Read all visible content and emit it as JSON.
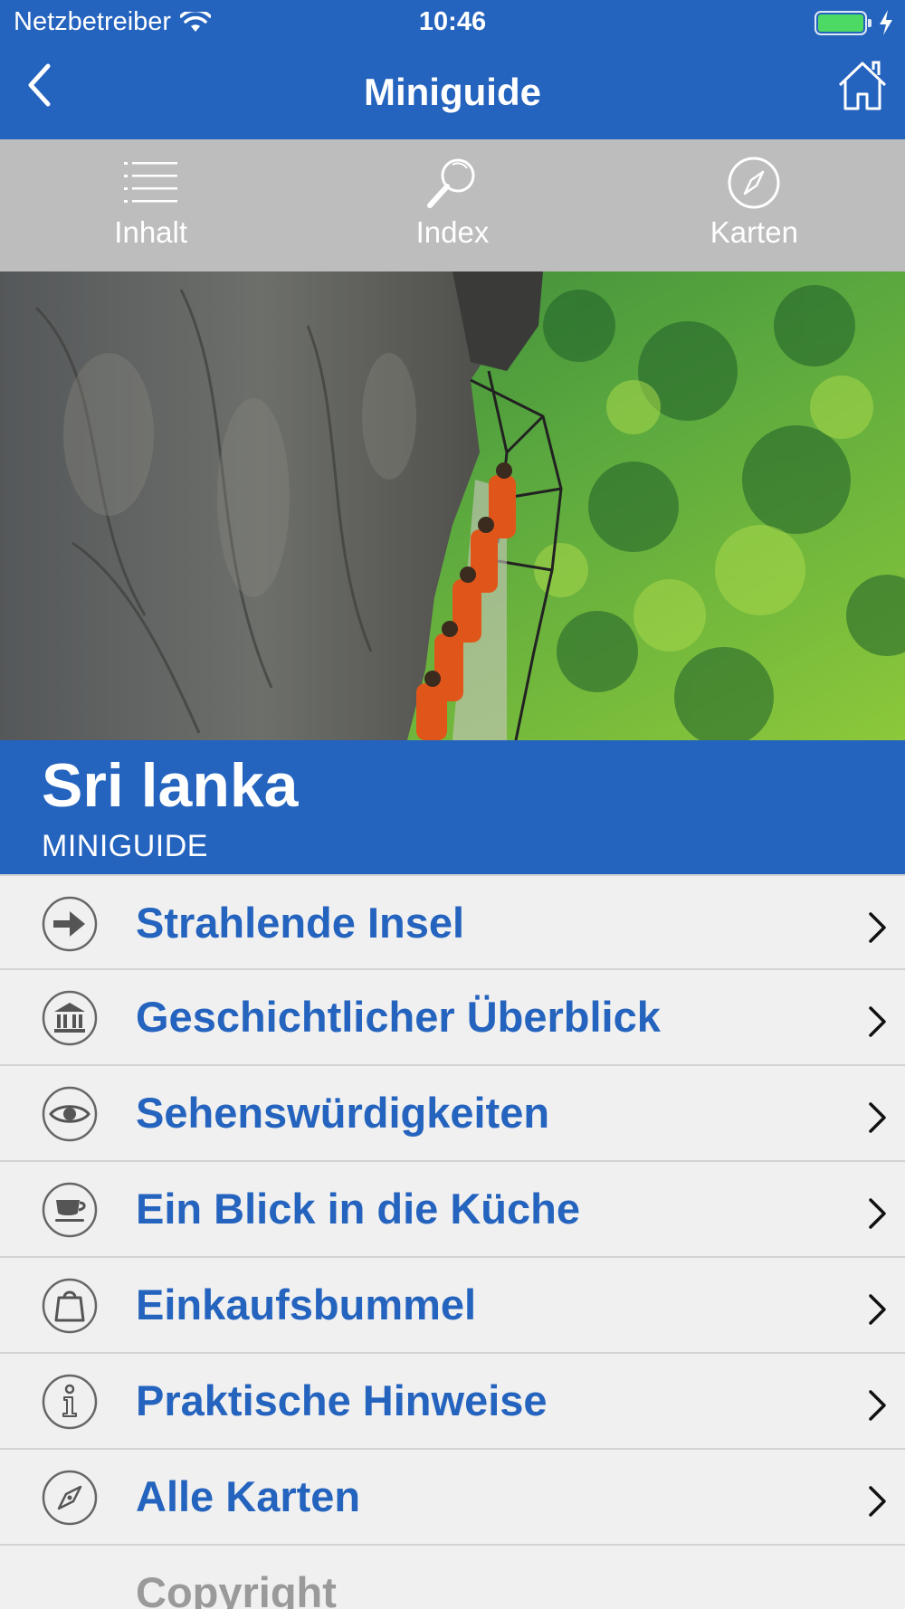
{
  "status_bar": {
    "carrier": "Netzbetreiber",
    "time": "10:46",
    "battery_level": 1.0,
    "battery_color": "#4cd964"
  },
  "nav": {
    "title": "Miniguide",
    "back_icon": "chevron-left-icon",
    "home_icon": "home-icon"
  },
  "tabs": [
    {
      "label": "Inhalt",
      "icon": "list-icon"
    },
    {
      "label": "Index",
      "icon": "magnifier-icon"
    },
    {
      "label": "Karten",
      "icon": "compass-icon"
    }
  ],
  "hero": {
    "description_icon": "hero-photo"
  },
  "header": {
    "title": "Sri lanka",
    "subtitle": "MINIGUIDE"
  },
  "menu": [
    {
      "label": "Strahlende Insel",
      "icon": "arrow-right-circle-icon"
    },
    {
      "label": "Geschichtlicher Überblick",
      "icon": "museum-icon"
    },
    {
      "label": "Sehenswürdigkeiten",
      "icon": "eye-icon"
    },
    {
      "label": "Ein Blick in die Küche",
      "icon": "cup-icon"
    },
    {
      "label": "Einkaufsbummel",
      "icon": "shopping-bag-icon"
    },
    {
      "label": "Praktische Hinweise",
      "icon": "info-icon"
    },
    {
      "label": "Alle Karten",
      "icon": "compass-icon"
    },
    {
      "label": "Copyright",
      "icon": ""
    }
  ],
  "colors": {
    "accent": "#2463be",
    "tabbar": "#bdbdbd",
    "list_bg": "#f0f0f0",
    "muted_text": "#9a9a9a"
  }
}
